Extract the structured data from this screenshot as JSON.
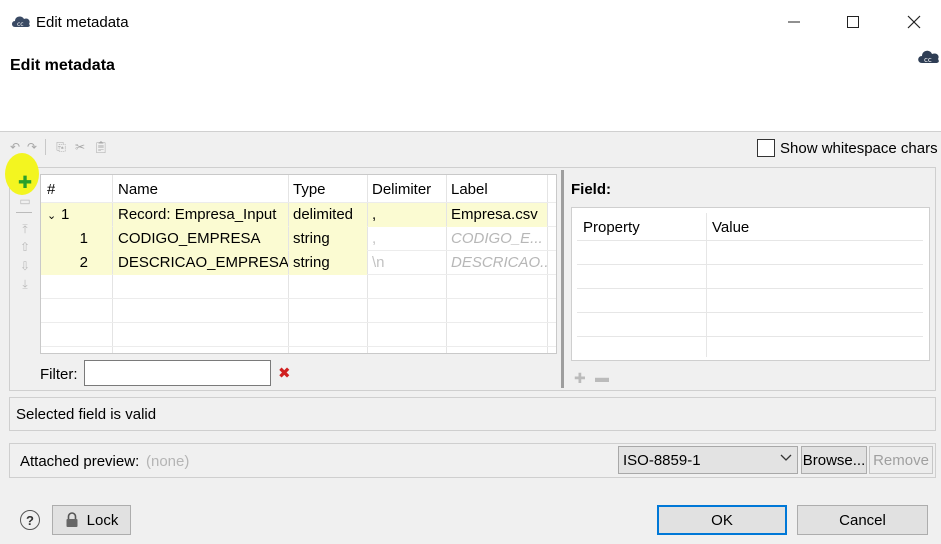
{
  "window": {
    "title": "Edit metadata",
    "header_title": "Edit metadata",
    "minimize_glyph": "—",
    "maximize_glyph": "☐",
    "close_glyph": "✕"
  },
  "toolbar": {
    "show_whitespace_label": "Show whitespace chars",
    "show_whitespace_checked": false
  },
  "table": {
    "columns": [
      "#",
      "Name",
      "Type",
      "Delimiter",
      "Label"
    ],
    "rows": [
      {
        "num": "1",
        "name": "Record: Empresa_Input",
        "type": "delimited",
        "delimiter": ",",
        "label": "Empresa.csv",
        "expanded": true
      },
      {
        "num": "1",
        "name": "CODIGO_EMPRESA",
        "type": "string",
        "delimiter": ",",
        "label": "CODIGO_E..."
      },
      {
        "num": "2",
        "name": "DESCRICAO_EMPRESA",
        "type": "string",
        "delimiter": "\\n",
        "label": "DESCRICAO..."
      }
    ]
  },
  "filter": {
    "label": "Filter:",
    "value": ""
  },
  "field_panel": {
    "title": "Field:",
    "columns": [
      "Property",
      "Value"
    ]
  },
  "status": {
    "message": "Selected field is valid"
  },
  "preview": {
    "label": "Attached preview:",
    "value": "(none)",
    "encoding": "ISO-8859-1",
    "browse_label": "Browse...",
    "remove_label": "Remove"
  },
  "footer": {
    "help_glyph": "?",
    "lock_label": "Lock",
    "ok_label": "OK",
    "cancel_label": "Cancel"
  },
  "colors": {
    "highlight": "#f3f520",
    "add_icon": "#2aa02a",
    "clear_icon": "#d02020",
    "default_button_border": "#0078d7"
  }
}
